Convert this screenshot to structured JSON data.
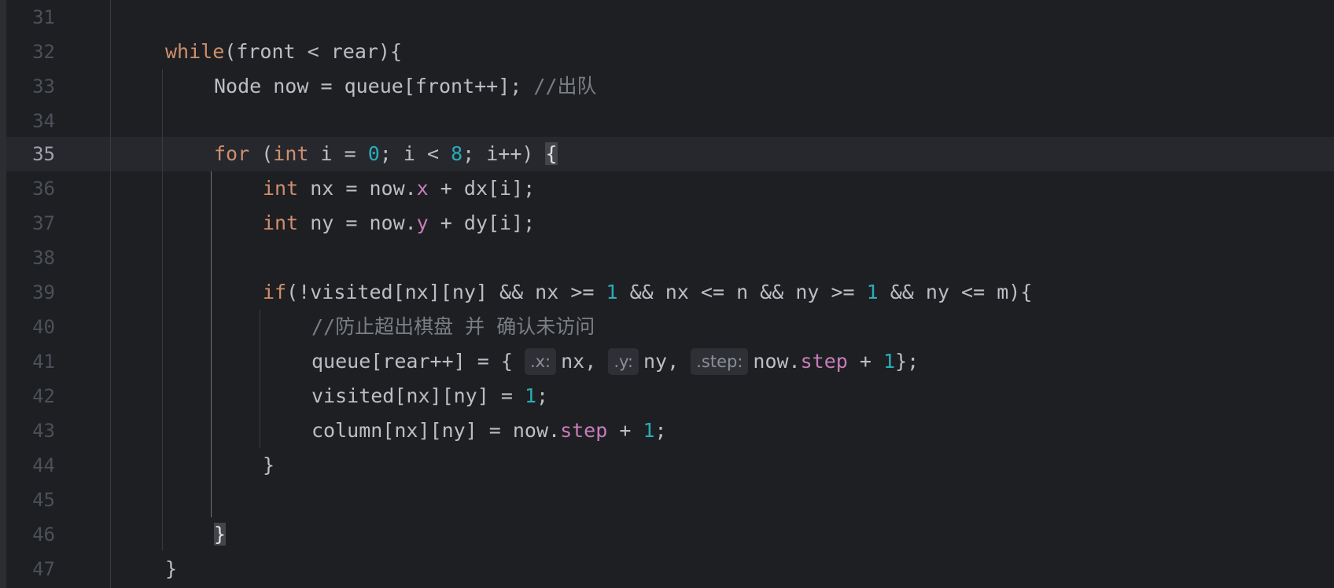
{
  "editor": {
    "current_line": "35",
    "lines": [
      {
        "num": "31"
      },
      {
        "num": "32",
        "t0": "while",
        "t1": "(front < rear){"
      },
      {
        "num": "33",
        "t0": "Node now = queue[front++]; ",
        "t1": "//出队"
      },
      {
        "num": "34"
      },
      {
        "num": "35",
        "t0": "for",
        "t1": " (",
        "t2": "int",
        "t3": " i = ",
        "t4": "0",
        "t5": "; i < ",
        "t6": "8",
        "t7": "; i++) ",
        "t8": "{"
      },
      {
        "num": "36",
        "t0": "int",
        "t1": " nx = now.",
        "t2": "x",
        "t3": " + dx[i];"
      },
      {
        "num": "37",
        "t0": "int",
        "t1": " ny = now.",
        "t2": "y",
        "t3": " + dy[i];"
      },
      {
        "num": "38"
      },
      {
        "num": "39",
        "t0": "if",
        "t1": "(!visited[nx][ny] && nx >= ",
        "t2": "1",
        "t3": " && nx <= n && ny >= ",
        "t4": "1",
        "t5": " && ny <= m){"
      },
      {
        "num": "40",
        "t0": "//防止超出棋盘 并 确认未访问"
      },
      {
        "num": "41",
        "t0": "queue[rear++] = {",
        "hint_x": ".x:",
        "t1": "nx,",
        "hint_y": ".y:",
        "t2": "ny,",
        "hint_step": ".step:",
        "t3": "now.",
        "t4": "step",
        "t5": " + ",
        "t6": "1",
        "t7": "};"
      },
      {
        "num": "42",
        "t0": "visited[nx][ny] = ",
        "t1": "1",
        "t2": ";"
      },
      {
        "num": "43",
        "t0": "column[nx][ny] = now.",
        "t1": "step",
        "t2": " + ",
        "t3": "1",
        "t4": ";"
      },
      {
        "num": "44",
        "t0": "}"
      },
      {
        "num": "45"
      },
      {
        "num": "46",
        "t0": "}"
      },
      {
        "num": "47",
        "t0": "}"
      }
    ]
  },
  "colors": {
    "background": "#1e1f22",
    "keyword": "#cf8e6d",
    "number": "#2aacb8",
    "field": "#c77dbb",
    "comment": "#7a7e85",
    "text": "#bcbec4",
    "line_number": "#4b5059"
  }
}
